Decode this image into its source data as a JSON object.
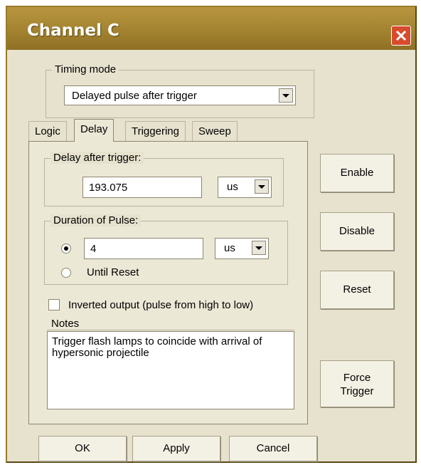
{
  "window": {
    "title": "Channel C"
  },
  "timing_mode": {
    "legend": "Timing mode",
    "selected": "Delayed pulse after trigger"
  },
  "tabs": [
    {
      "label": "Logic"
    },
    {
      "label": "Delay"
    },
    {
      "label": "Triggering"
    },
    {
      "label": "Sweep"
    }
  ],
  "delay": {
    "legend": "Delay after trigger:",
    "value": "193.075",
    "unit": "us"
  },
  "duration": {
    "legend": "Duration of Pulse:",
    "value": "4",
    "unit": "us",
    "until_reset_label": "Until Reset"
  },
  "inverted_label": "Inverted output (pulse from high to low)",
  "notes": {
    "legend": "Notes",
    "text": "Trigger flash lamps to coincide with arrival of hypersonic projectile"
  },
  "side_buttons": {
    "enable": "Enable",
    "disable": "Disable",
    "reset": "Reset",
    "force_line1": "Force",
    "force_line2": "Trigger"
  },
  "bottom_buttons": {
    "ok": "OK",
    "apply": "Apply",
    "cancel": "Cancel"
  }
}
